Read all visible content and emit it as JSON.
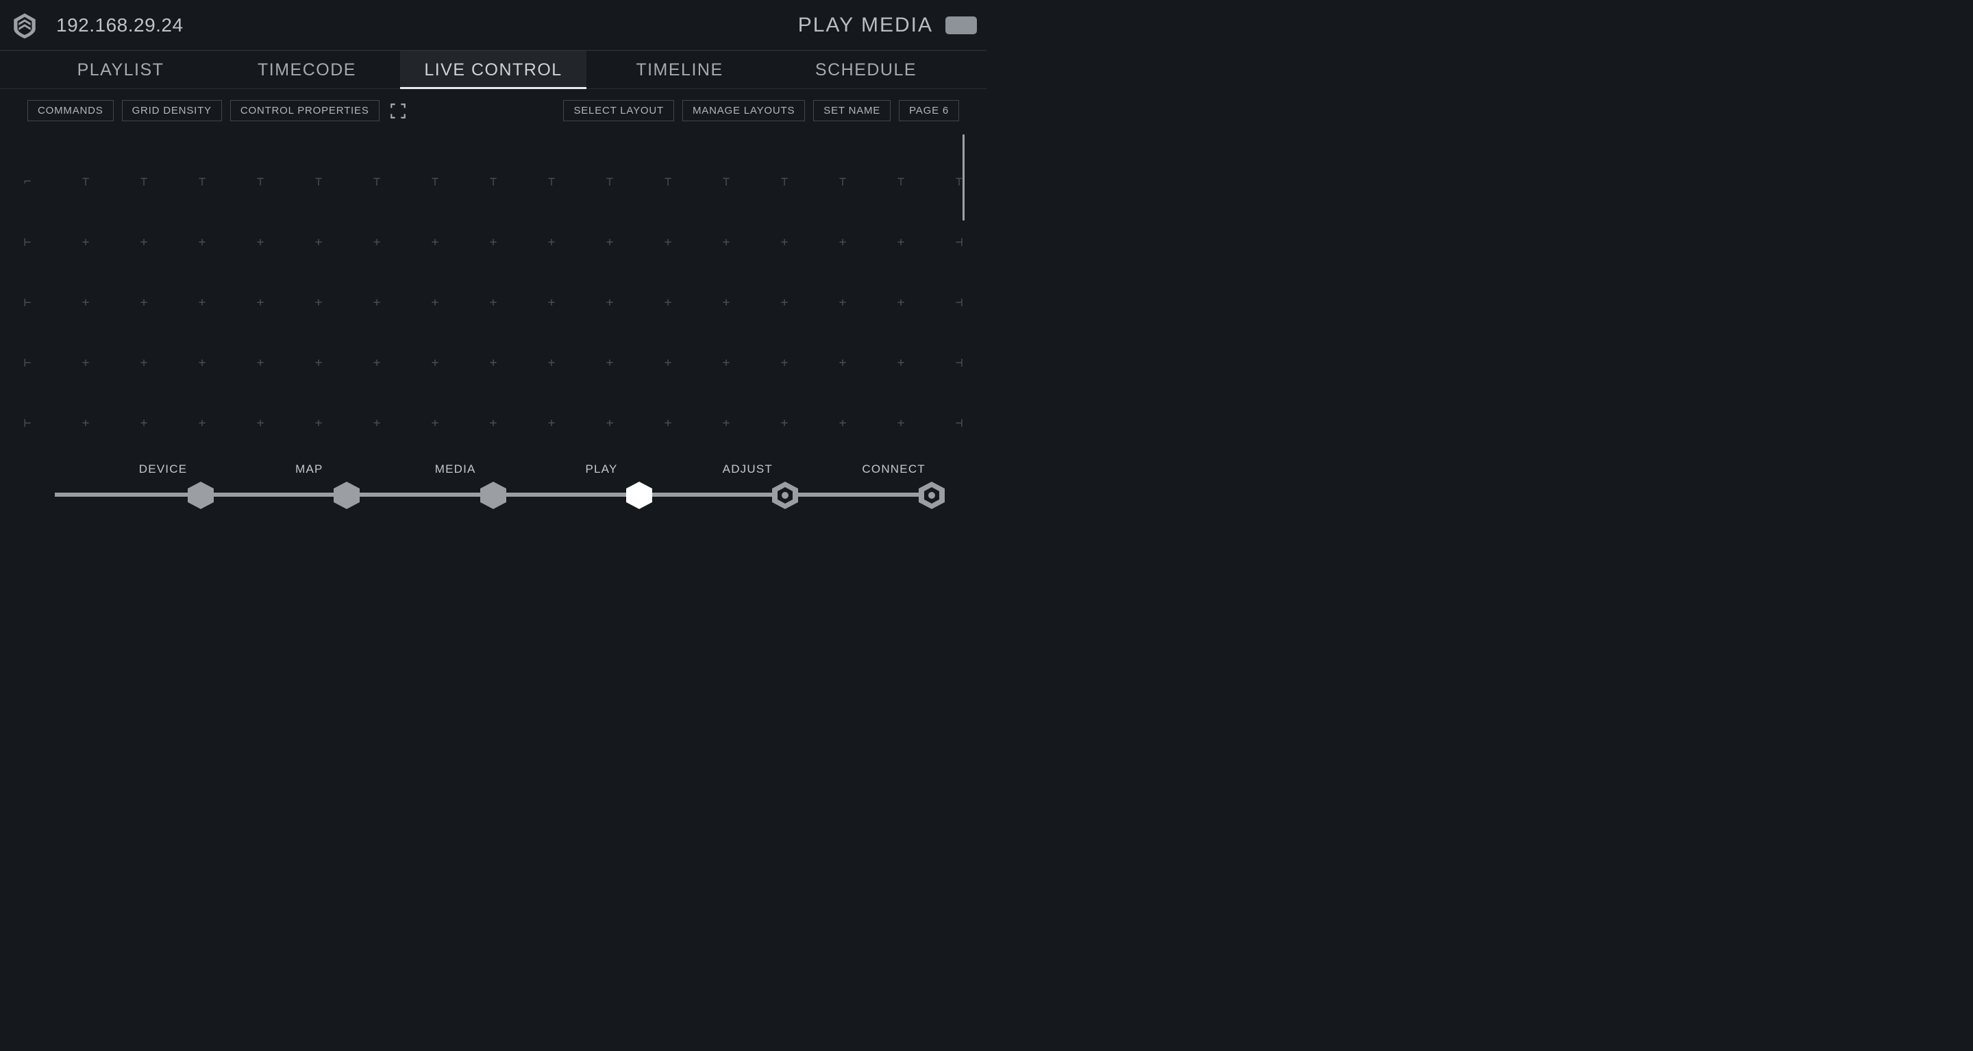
{
  "header": {
    "ip": "192.168.29.24",
    "page_title": "PLAY MEDIA"
  },
  "tabs": [
    {
      "label": "PLAYLIST",
      "active": false
    },
    {
      "label": "TIMECODE",
      "active": false
    },
    {
      "label": "LIVE CONTROL",
      "active": true
    },
    {
      "label": "TIMELINE",
      "active": false
    },
    {
      "label": "SCHEDULE",
      "active": false
    }
  ],
  "toolbar": {
    "commands": "COMMANDS",
    "grid_density": "GRID DENSITY",
    "control_properties": "CONTROL PROPERTIES",
    "select_layout": "SELECT LAYOUT",
    "manage_layouts": "MANAGE LAYOUTS",
    "set_name": "SET NAME",
    "page_label": "PAGE 6"
  },
  "grid": {
    "cols": 17,
    "rows": 5
  },
  "workflow": [
    {
      "label": "DEVICE",
      "state": "done"
    },
    {
      "label": "MAP",
      "state": "done"
    },
    {
      "label": "MEDIA",
      "state": "done"
    },
    {
      "label": "PLAY",
      "state": "active"
    },
    {
      "label": "ADJUST",
      "state": "todo"
    },
    {
      "label": "CONNECT",
      "state": "todo"
    }
  ]
}
